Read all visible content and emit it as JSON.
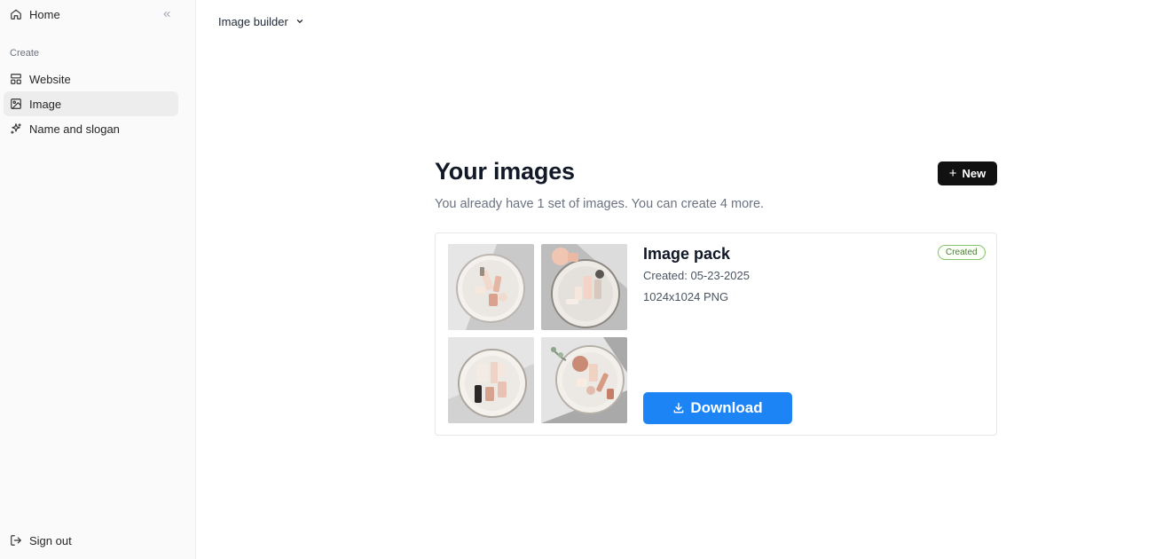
{
  "sidebar": {
    "home_label": "Home",
    "section_label": "Create",
    "items": [
      {
        "label": "Website",
        "icon": "layout-icon"
      },
      {
        "label": "Image",
        "icon": "image-icon"
      },
      {
        "label": "Name and slogan",
        "icon": "sparkles-icon"
      }
    ],
    "signout_label": "Sign out"
  },
  "topbar": {
    "builder_label": "Image builder"
  },
  "main": {
    "title": "Your images",
    "subtitle": "You already have 1 set of images. You can create 4 more.",
    "new_button_label": "New"
  },
  "card": {
    "title": "Image pack",
    "created": "Created: 05-23-2025",
    "format": "1024x1024 PNG",
    "badge": "Created",
    "download_label": "Download"
  },
  "colors": {
    "accent": "#1d84f5",
    "dark_button": "#111111",
    "badge_border": "#86c46b"
  }
}
